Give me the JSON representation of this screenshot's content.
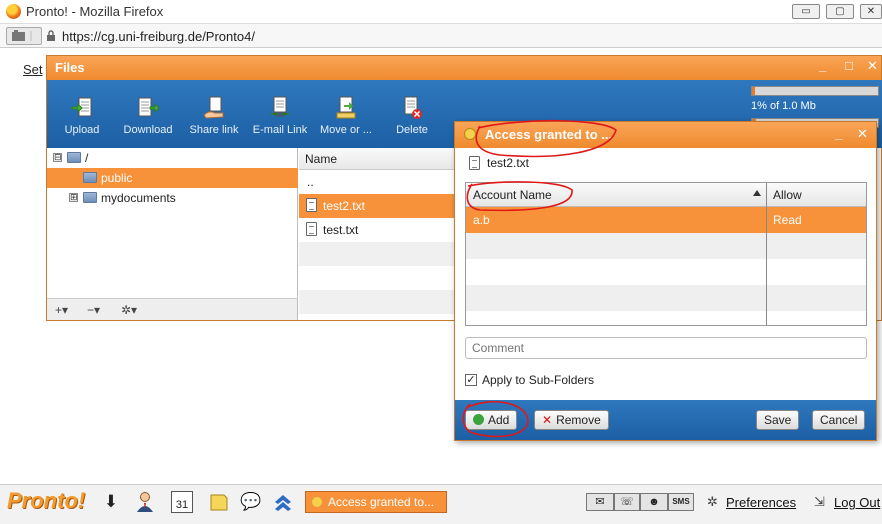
{
  "browser": {
    "window_title": "Pronto! - Mozilla Firefox",
    "url": "https://cg.uni-freiburg.de/Pronto4/",
    "controls": [
      "▭",
      "▢",
      "✕"
    ]
  },
  "page": {
    "link_fragment": "Set"
  },
  "files_window": {
    "title": "Files",
    "controls": {
      "minimize": "_",
      "maximize": "□",
      "close": "✕"
    },
    "toolbar": {
      "upload": "Upload",
      "download": "Download",
      "share_link": "Share link",
      "email_link": "E-mail Link",
      "move": "Move or ...",
      "delete": "Delete"
    },
    "quota": {
      "text": "1% of 1.0 Mb",
      "fraction": 0.01
    },
    "tree": [
      {
        "label": "/",
        "expander": "⊟"
      },
      {
        "label": "public",
        "selected": true
      },
      {
        "label": "mydocuments",
        "expander": "⊞"
      }
    ],
    "tree_footer": {
      "add": "+▾",
      "remove": "−▾",
      "settings": "✲▾"
    },
    "list": {
      "header": "Name",
      "rows": [
        {
          "name": ".."
        },
        {
          "name": "test2.txt",
          "selected": true
        },
        {
          "name": "test.txt"
        }
      ]
    }
  },
  "dialog": {
    "title": "Access granted to ...",
    "controls": {
      "minimize": "_",
      "close": "✕"
    },
    "file_name": "test2.txt",
    "columns": {
      "account": "Account Name",
      "allow": "Allow"
    },
    "rows": [
      {
        "account": "a.b",
        "allow": "Read"
      }
    ],
    "comment_placeholder": "Comment",
    "apply_subfolders_label": "Apply to Sub-Folders",
    "apply_subfolders_checked": "✓",
    "buttons": {
      "add": "Add",
      "remove": "Remove",
      "save": "Save",
      "cancel": "Cancel"
    }
  },
  "taskbar": {
    "logo": "Pronto!",
    "calendar_day": "31",
    "task": "Access granted to...",
    "preferences": "Preferences",
    "logout": "Log Out",
    "phone_group": {
      "mail": "✉",
      "phone": "☏",
      "user": "☻",
      "sms": "SMS"
    }
  },
  "colors": {
    "orange": "#f7923a",
    "blue_toolbar": "#2f78be",
    "annotation_red": "#e01818"
  }
}
